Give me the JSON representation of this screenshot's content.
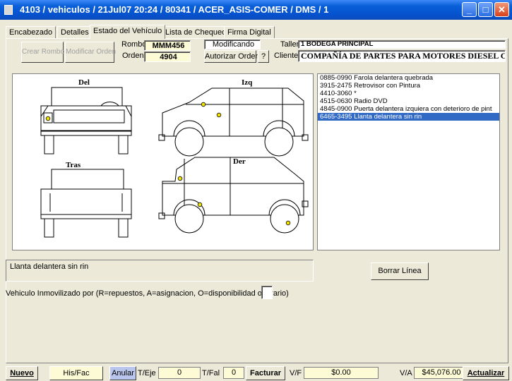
{
  "window": {
    "title": "4103 / vehiculos / 21Jul07 20:24 / 80341 / ACER_ASIS-COMER / DMS / 1",
    "minimize_glyph": "_",
    "maximize_glyph": "□",
    "close_glyph": "✕"
  },
  "tabs": [
    "Encabezado",
    "Detalles",
    "Estado del Vehículo",
    "Lista de Chequeo",
    "Firma Digital"
  ],
  "toolbar": {
    "crear_rombo": "Crear Rombo",
    "modificar_orden": "Modificar Orden",
    "rombo_label": "Rombo",
    "rombo_value": "MMM456",
    "orden_label": "Orden",
    "orden_value": "4904",
    "mode_value": "Modificando",
    "autorizar_orden": "Autorizar Orden",
    "help": "?",
    "taller_label": "Taller",
    "taller_value": "1 BODEGA PRINCIPAL",
    "cliente_label": "Cliente",
    "cliente_value": "COMPAÑÍA DE PARTES PARA MOTORES DIESEL COD"
  },
  "diagram": {
    "front_label": "Del",
    "left_label": "Izq",
    "rear_label": "Tras",
    "right_label": "Der",
    "marker_color": "#f2e600"
  },
  "damage_list": {
    "items": [
      "0885-0990 Farola delantera quebrada",
      "3915-2475 Retrovisor con Pintura",
      "4410-3060 *",
      "4515-0630 Radio DVD",
      "4845-0900 Puerta delantera izquiera con deterioro de pint",
      "6465-3495 Llanta delantera sin rin"
    ],
    "selected_index": 5
  },
  "selected_description": "Llanta delantera sin rin",
  "borrar_linea": "Borrar Línea",
  "inmovilizado_label": "Vehiculo Inmovilizado por (R=repuestos, A=asignacion, O=disponibilidad operario)",
  "inmovilizado_value": "",
  "bottom": {
    "nuevo": "Nuevo",
    "his_fac": "His/Fac",
    "anular": "Anular",
    "t_eje_label": "T/Eje",
    "t_eje_value": "0",
    "t_fal_label": "T/Fal",
    "t_fal_value": "0",
    "facturar": "Facturar",
    "vf_label": "V/F",
    "vf_value": "$0.00",
    "va_label": "V/A",
    "va_value": "$45,076.00",
    "actualizar": "Actualizar"
  }
}
